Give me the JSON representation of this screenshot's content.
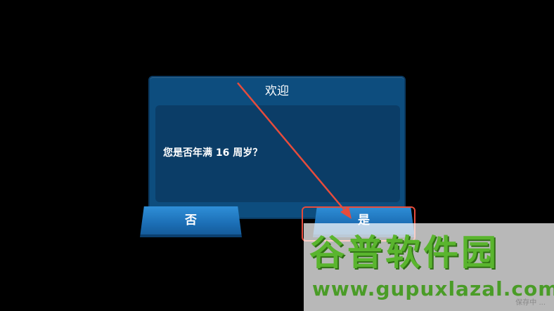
{
  "dialog": {
    "title": "欢迎",
    "message": "您是否年满 16 周岁？"
  },
  "buttons": {
    "no_label": "否",
    "yes_label": "是"
  },
  "annotation": {
    "color": "#e74c3c"
  },
  "watermark": {
    "title": "谷普软件园",
    "url": "www.gupuxlazal.com",
    "small_text": "保存中 ..."
  }
}
